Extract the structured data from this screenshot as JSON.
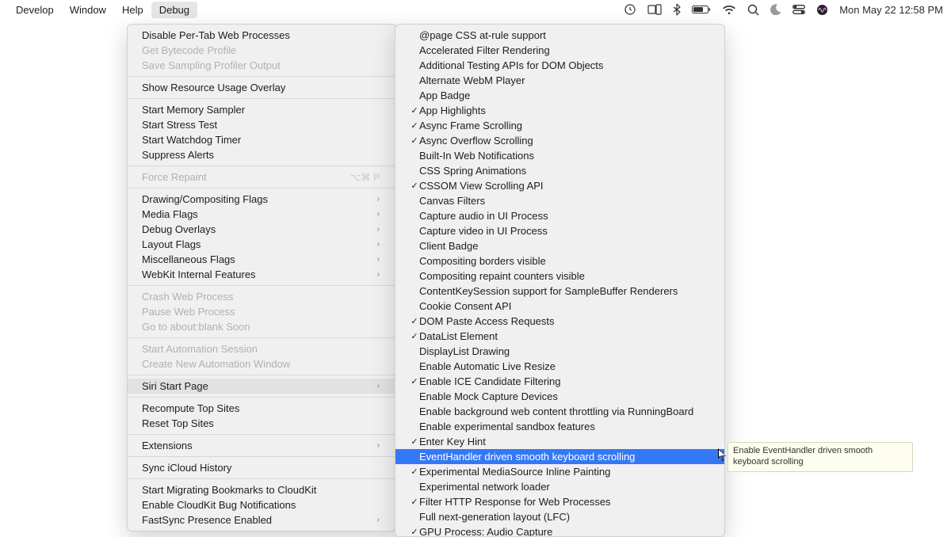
{
  "menubar": {
    "items": [
      "Develop",
      "Window",
      "Help",
      "Debug"
    ],
    "active_index": 3,
    "clock": "Mon May 22  12:58 PM"
  },
  "menu1": {
    "hover_index": 20,
    "groups": [
      [
        {
          "label": "Disable Per-Tab Web Processes"
        },
        {
          "label": "Get Bytecode Profile",
          "disabled": true
        },
        {
          "label": "Save Sampling Profiler Output",
          "disabled": true
        }
      ],
      [
        {
          "label": "Show Resource Usage Overlay"
        }
      ],
      [
        {
          "label": "Start Memory Sampler"
        },
        {
          "label": "Start Stress Test"
        },
        {
          "label": "Start Watchdog Timer"
        },
        {
          "label": "Suppress Alerts"
        }
      ],
      [
        {
          "label": "Force Repaint",
          "disabled": true,
          "shortcut": "⌥⌘ P"
        }
      ],
      [
        {
          "label": "Drawing/Compositing Flags",
          "submenu": true
        },
        {
          "label": "Media Flags",
          "submenu": true
        },
        {
          "label": "Debug Overlays",
          "submenu": true
        },
        {
          "label": "Layout Flags",
          "submenu": true
        },
        {
          "label": "Miscellaneous Flags",
          "submenu": true
        },
        {
          "label": "WebKit Internal Features",
          "submenu": true
        }
      ],
      [
        {
          "label": "Crash Web Process",
          "disabled": true
        },
        {
          "label": "Pause Web Process",
          "disabled": true
        },
        {
          "label": "Go to about:blank Soon",
          "disabled": true
        }
      ],
      [
        {
          "label": "Start Automation Session",
          "disabled": true
        },
        {
          "label": "Create New Automation Window",
          "disabled": true
        }
      ],
      [
        {
          "label": "Siri Start Page",
          "submenu": true
        }
      ],
      [
        {
          "label": "Recompute Top Sites"
        },
        {
          "label": "Reset Top Sites"
        }
      ],
      [
        {
          "label": "Extensions",
          "submenu": true
        }
      ],
      [
        {
          "label": "Sync iCloud History"
        }
      ],
      [
        {
          "label": "Start Migrating Bookmarks to CloudKit"
        },
        {
          "label": "Enable CloudKit Bug Notifications"
        },
        {
          "label": "FastSync Presence Enabled",
          "submenu": true
        }
      ]
    ]
  },
  "menu2": {
    "highlight_index": 28,
    "items": [
      {
        "label": "@page CSS at-rule support"
      },
      {
        "label": "Accelerated Filter Rendering"
      },
      {
        "label": "Additional Testing APIs for DOM Objects"
      },
      {
        "label": "Alternate WebM Player"
      },
      {
        "label": "App Badge"
      },
      {
        "label": "App Highlights",
        "checked": true
      },
      {
        "label": "Async Frame Scrolling",
        "checked": true
      },
      {
        "label": "Async Overflow Scrolling",
        "checked": true
      },
      {
        "label": "Built-In Web Notifications"
      },
      {
        "label": "CSS Spring Animations"
      },
      {
        "label": "CSSOM View Scrolling API",
        "checked": true
      },
      {
        "label": "Canvas Filters"
      },
      {
        "label": "Capture audio in UI Process"
      },
      {
        "label": "Capture video in UI Process"
      },
      {
        "label": "Client Badge"
      },
      {
        "label": "Compositing borders visible"
      },
      {
        "label": "Compositing repaint counters visible"
      },
      {
        "label": "ContentKeySession support for SampleBuffer Renderers"
      },
      {
        "label": "Cookie Consent API"
      },
      {
        "label": "DOM Paste Access Requests",
        "checked": true
      },
      {
        "label": "DataList Element",
        "checked": true
      },
      {
        "label": "DisplayList Drawing"
      },
      {
        "label": "Enable Automatic Live Resize"
      },
      {
        "label": "Enable ICE Candidate Filtering",
        "checked": true
      },
      {
        "label": "Enable Mock Capture Devices"
      },
      {
        "label": "Enable background web content throttling via RunningBoard"
      },
      {
        "label": "Enable experimental sandbox features"
      },
      {
        "label": "Enter Key Hint",
        "checked": true
      },
      {
        "label": "EventHandler driven smooth keyboard scrolling"
      },
      {
        "label": "Experimental MediaSource Inline Painting",
        "checked": true
      },
      {
        "label": "Experimental network loader"
      },
      {
        "label": "Filter HTTP Response for Web Processes",
        "checked": true
      },
      {
        "label": "Full next-generation layout (LFC)"
      },
      {
        "label": "GPU Process: Audio Capture",
        "checked": true
      }
    ]
  },
  "tooltip": {
    "text": "Enable EventHandler driven smooth keyboard scrolling"
  }
}
